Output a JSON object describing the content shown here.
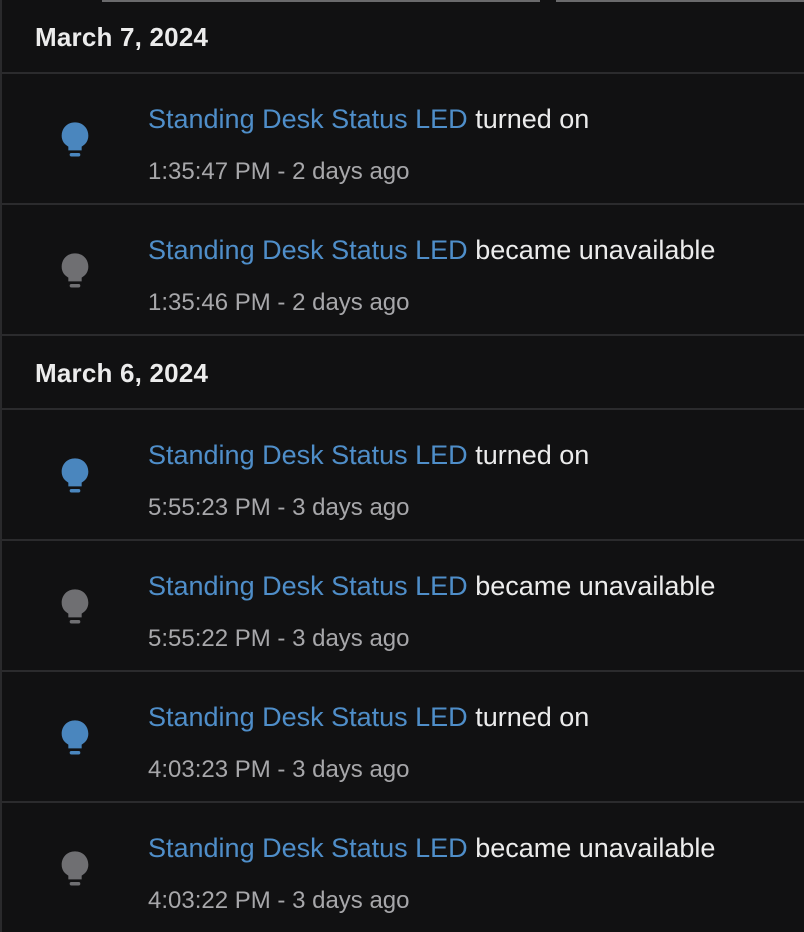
{
  "colors": {
    "background": "#111112",
    "divider": "#2b2b2d",
    "link": "#4f8ec9",
    "icon_on": "#4a86be",
    "icon_unavailable": "#6f6f72",
    "text_primary": "#ececec",
    "text_secondary": "#a7a7aa"
  },
  "groups": [
    {
      "date": "March 7, 2024",
      "entries": [
        {
          "entity": "Standing Desk Status LED",
          "action": "turned on",
          "time": "1:35:47 PM",
          "sep": " - ",
          "relative": "2 days ago",
          "icon": "lightbulb-on-icon"
        },
        {
          "entity": "Standing Desk Status LED",
          "action": "became unavailable",
          "time": "1:35:46 PM",
          "sep": " - ",
          "relative": "2 days ago",
          "icon": "lightbulb-unavailable-icon"
        }
      ]
    },
    {
      "date": "March 6, 2024",
      "entries": [
        {
          "entity": "Standing Desk Status LED",
          "action": "turned on",
          "time": "5:55:23 PM",
          "sep": " - ",
          "relative": "3 days ago",
          "icon": "lightbulb-on-icon"
        },
        {
          "entity": "Standing Desk Status LED",
          "action": "became unavailable",
          "time": "5:55:22 PM",
          "sep": " - ",
          "relative": "3 days ago",
          "icon": "lightbulb-unavailable-icon"
        },
        {
          "entity": "Standing Desk Status LED",
          "action": "turned on",
          "time": "4:03:23 PM",
          "sep": " - ",
          "relative": "3 days ago",
          "icon": "lightbulb-on-icon"
        },
        {
          "entity": "Standing Desk Status LED",
          "action": "became unavailable",
          "time": "4:03:22 PM",
          "sep": " - ",
          "relative": "3 days ago",
          "icon": "lightbulb-unavailable-icon"
        }
      ]
    }
  ]
}
